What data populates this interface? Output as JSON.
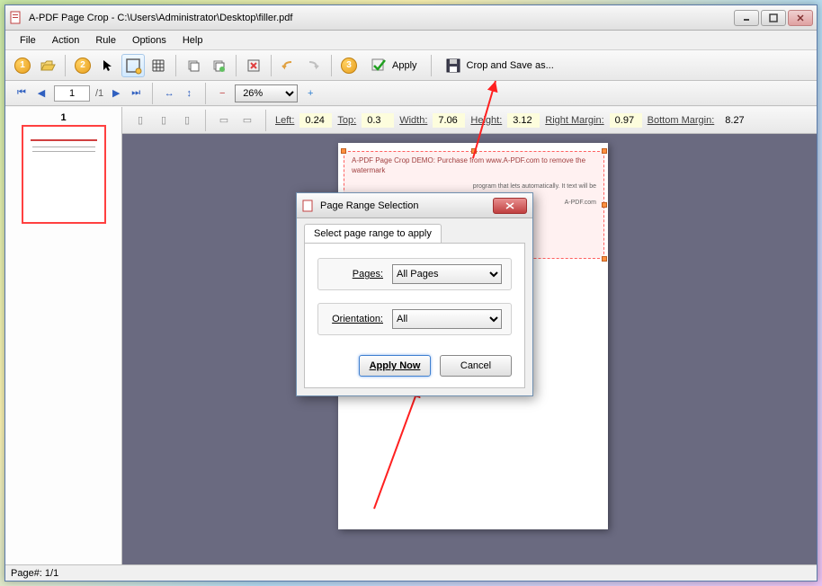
{
  "window": {
    "title": "A-PDF Page Crop - C:\\Users\\Administrator\\Desktop\\filler.pdf",
    "minimize": "–",
    "maximize": "□",
    "close": "×"
  },
  "menu": {
    "file": "File",
    "action": "Action",
    "rule": "Rule",
    "options": "Options",
    "help": "Help"
  },
  "steps": {
    "one": "1",
    "two": "2",
    "three": "3"
  },
  "toolbar": {
    "apply": "Apply",
    "crop_save": "Crop and Save as..."
  },
  "nav": {
    "page": "1",
    "total": "/1",
    "zoom": "26%"
  },
  "thumb": {
    "num": "1"
  },
  "props": {
    "left_label": "Left:",
    "left": "0.24",
    "top_label": "Top:",
    "top": "0.3",
    "width_label": "Width:",
    "width": "7.06",
    "height_label": "Height:",
    "height": "3.12",
    "rm_label": "Right Margin:",
    "rm": "0.97",
    "bm_label": "Bottom Margin:",
    "bm": "8.27"
  },
  "page_preview": {
    "header": "A-PDF Page Crop DEMO: Purchase from www.A-PDF.com to remove the watermark",
    "body": "program that lets automatically. It text will be",
    "footer": "A-PDF.com"
  },
  "dialog": {
    "title": "Page Range Selection",
    "tab": "Select page range to apply",
    "pages_label": "Pages:",
    "pages_value": "All Pages",
    "orient_label": "Orientation:",
    "orient_value": "All",
    "apply_now": "Apply Now",
    "cancel": "Cancel"
  },
  "status": {
    "text": "Page#: 1/1"
  }
}
